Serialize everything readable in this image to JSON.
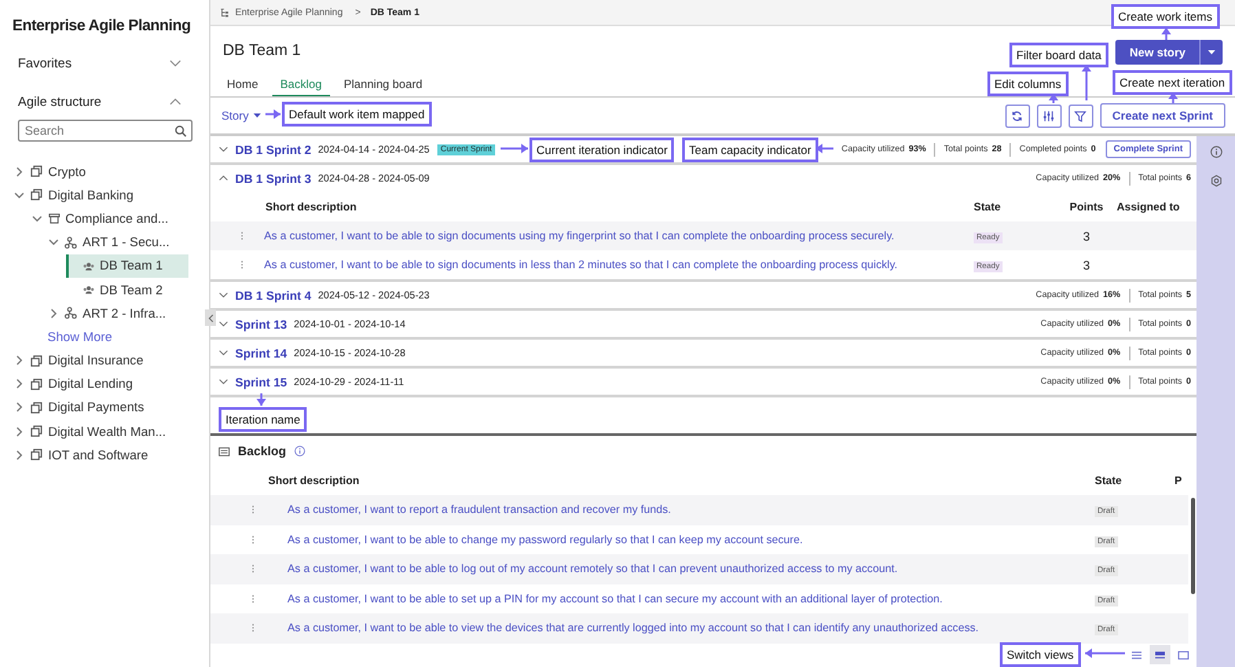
{
  "sidebar": {
    "title": "Enterprise Agile Planning",
    "sections": [
      {
        "label": "Favorites",
        "expanded": false
      },
      {
        "label": "Agile structure",
        "expanded": true
      }
    ],
    "search": {
      "placeholder": "Search"
    },
    "tree": [
      {
        "label": "Crypto",
        "kind": "portfolio",
        "expanded": false,
        "selected": false
      },
      {
        "label": "Digital Banking",
        "kind": "portfolio",
        "expanded": true,
        "selected": false,
        "children": [
          {
            "label": "Compliance and...",
            "kind": "program",
            "expanded": true,
            "selected": false,
            "children": [
              {
                "label": "ART 1 - Secu...",
                "kind": "art",
                "expanded": true,
                "selected": false,
                "children": [
                  {
                    "label": "DB Team 1",
                    "kind": "team",
                    "selected": true
                  },
                  {
                    "label": "DB Team 2",
                    "kind": "team",
                    "selected": false
                  }
                ]
              },
              {
                "label": "ART 2 - Infra...",
                "kind": "art",
                "expanded": false,
                "selected": false
              }
            ]
          },
          {
            "label": "Show More",
            "kind": "link"
          }
        ]
      },
      {
        "label": "Digital Insurance",
        "kind": "portfolio",
        "expanded": false,
        "selected": false
      },
      {
        "label": "Digital Lending",
        "kind": "portfolio",
        "expanded": false,
        "selected": false
      },
      {
        "label": "Digital Payments",
        "kind": "portfolio",
        "expanded": false,
        "selected": false
      },
      {
        "label": "Digital Wealth Man...",
        "kind": "portfolio",
        "expanded": false,
        "selected": false
      },
      {
        "label": "IOT and Software",
        "kind": "portfolio",
        "expanded": false,
        "selected": false
      }
    ]
  },
  "breadcrumb": {
    "items": [
      "Enterprise Agile Planning",
      "DB Team 1"
    ],
    "separator": ">"
  },
  "page_title": "DB Team 1",
  "new_button": "New story",
  "tabs": [
    {
      "label": "Home",
      "selected": false
    },
    {
      "label": "Backlog",
      "selected": true
    },
    {
      "label": "Planning board",
      "selected": false
    }
  ],
  "toolbar": {
    "work_item_type": "Story",
    "create_button": "Create next Sprint"
  },
  "sprints": [
    {
      "name": "DB 1 Sprint 2",
      "dates": "2024-04-14 - 2024-04-25",
      "expanded": false,
      "badge": "Current Sprint",
      "stats": [
        {
          "label": "Capacity utilized",
          "value": "93%"
        },
        {
          "label": "Total points",
          "value": "28"
        },
        {
          "label": "Completed points",
          "value": "0"
        }
      ],
      "action": "Complete Sprint"
    },
    {
      "name": "DB 1 Sprint 3",
      "dates": "2024-04-28 - 2024-05-09",
      "expanded": true,
      "stats": [
        {
          "label": "Capacity utilized",
          "value": "20%"
        },
        {
          "label": "Total points",
          "value": "6"
        }
      ],
      "columns": [
        "Short description",
        "State",
        "Points",
        "Assigned to"
      ],
      "rows": [
        {
          "description": "As a customer, I want to be able to sign documents using my fingerprint so that I can complete the onboarding process securely.",
          "state": "Ready",
          "points": "3"
        },
        {
          "description": "As a customer, I want to be able to sign documents in less than 2 minutes so that I can complete the onboarding process quickly.",
          "state": "Ready",
          "points": "3"
        }
      ]
    },
    {
      "name": "DB 1 Sprint 4",
      "dates": "2024-05-12 - 2024-05-23",
      "expanded": false,
      "stats": [
        {
          "label": "Capacity utilized",
          "value": "16%"
        },
        {
          "label": "Total points",
          "value": "5"
        }
      ]
    },
    {
      "name": "Sprint 13",
      "dates": "2024-10-01 - 2024-10-14",
      "expanded": false,
      "stats": [
        {
          "label": "Capacity utilized",
          "value": "0%"
        },
        {
          "label": "Total points",
          "value": "0"
        }
      ]
    },
    {
      "name": "Sprint 14",
      "dates": "2024-10-15 - 2024-10-28",
      "expanded": false,
      "stats": [
        {
          "label": "Capacity utilized",
          "value": "0%"
        },
        {
          "label": "Total points",
          "value": "0"
        }
      ]
    },
    {
      "name": "Sprint 15",
      "dates": "2024-10-29 - 2024-11-11",
      "expanded": false,
      "stats": [
        {
          "label": "Capacity utilized",
          "value": "0%"
        },
        {
          "label": "Total points",
          "value": "0"
        }
      ]
    }
  ],
  "backlog": {
    "title": "Backlog",
    "columns": [
      "Short description",
      "State",
      "P"
    ],
    "rows": [
      {
        "description": "As a customer, I want to report a fraudulent transaction and recover my funds.",
        "state": "Draft"
      },
      {
        "description": "As a customer, I want to be able to change my password regularly so that I can keep my account secure.",
        "state": "Draft"
      },
      {
        "description": "As a customer, I want to be able to log out of my account remotely so that I can prevent unauthorized access to my account.",
        "state": "Draft"
      },
      {
        "description": "As a customer, I want to be able to set up a PIN for my account so that I can secure my account with an additional layer of protection.",
        "state": "Draft"
      },
      {
        "description": "As a customer, I want to be able to view the devices that are currently logged into my account so that I can identify any unauthorized access.",
        "state": "Draft"
      }
    ]
  },
  "view_modes": [
    {
      "kind": "list",
      "selected": false
    },
    {
      "kind": "compact",
      "selected": true
    },
    {
      "kind": "card",
      "selected": false
    }
  ],
  "annotations": [
    {
      "text": "Create work items"
    },
    {
      "text": "Filter board data"
    },
    {
      "text": "Edit columns"
    },
    {
      "text": "Create next iteration"
    },
    {
      "text": "Default work item mapped"
    },
    {
      "text": "Current iteration indicator"
    },
    {
      "text": "Team capacity indicator"
    },
    {
      "text": "Iteration name"
    },
    {
      "text": "Switch views"
    }
  ]
}
